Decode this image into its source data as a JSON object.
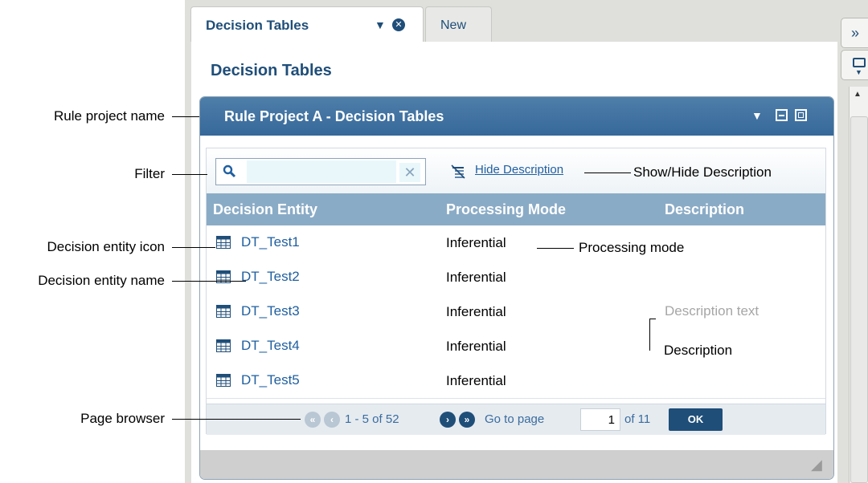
{
  "tabs": [
    {
      "label": "Decision Tables",
      "active": true
    },
    {
      "label": "New",
      "active": false
    }
  ],
  "page_title": "Decision Tables",
  "panel": {
    "title": "Rule Project A - Decision Tables"
  },
  "toolbar": {
    "filter_value": "",
    "hide_description_label": "Hide Description"
  },
  "table": {
    "headers": [
      "Decision Entity",
      "Processing Mode",
      "Description"
    ],
    "rows": [
      {
        "name": "DT_Test1",
        "mode": "Inferential",
        "description": ""
      },
      {
        "name": "DT_Test2",
        "mode": "Inferential",
        "description": ""
      },
      {
        "name": "DT_Test3",
        "mode": "Inferential",
        "description": "Description text"
      },
      {
        "name": "DT_Test4",
        "mode": "Inferential",
        "description": ""
      },
      {
        "name": "DT_Test5",
        "mode": "Inferential",
        "description": ""
      }
    ]
  },
  "pager": {
    "range": "1 - 5 of 52",
    "goto_label": "Go to page",
    "page_value": "1",
    "of_pages": "of 11",
    "ok_label": "OK"
  },
  "callouts": {
    "rule_project_name": "Rule project name",
    "filter": "Filter",
    "entity_icon": "Decision entity icon",
    "entity_name": "Decision entity name",
    "page_browser": "Page browser",
    "show_hide_description": "Show/Hide Description",
    "processing_mode": "Processing mode",
    "description": "Description"
  },
  "colors": {
    "header_blue": "#36689a",
    "table_header": "#8aabc6",
    "link_blue": "#1f5fa0",
    "title_blue": "#1f4e79"
  },
  "icons": [
    "close-icon",
    "chevron-down-icon",
    "search-icon",
    "clear-icon",
    "hide-description-icon",
    "table-icon",
    "first-page-icon",
    "prev-page-icon",
    "next-page-icon",
    "last-page-icon",
    "expand-icon"
  ]
}
